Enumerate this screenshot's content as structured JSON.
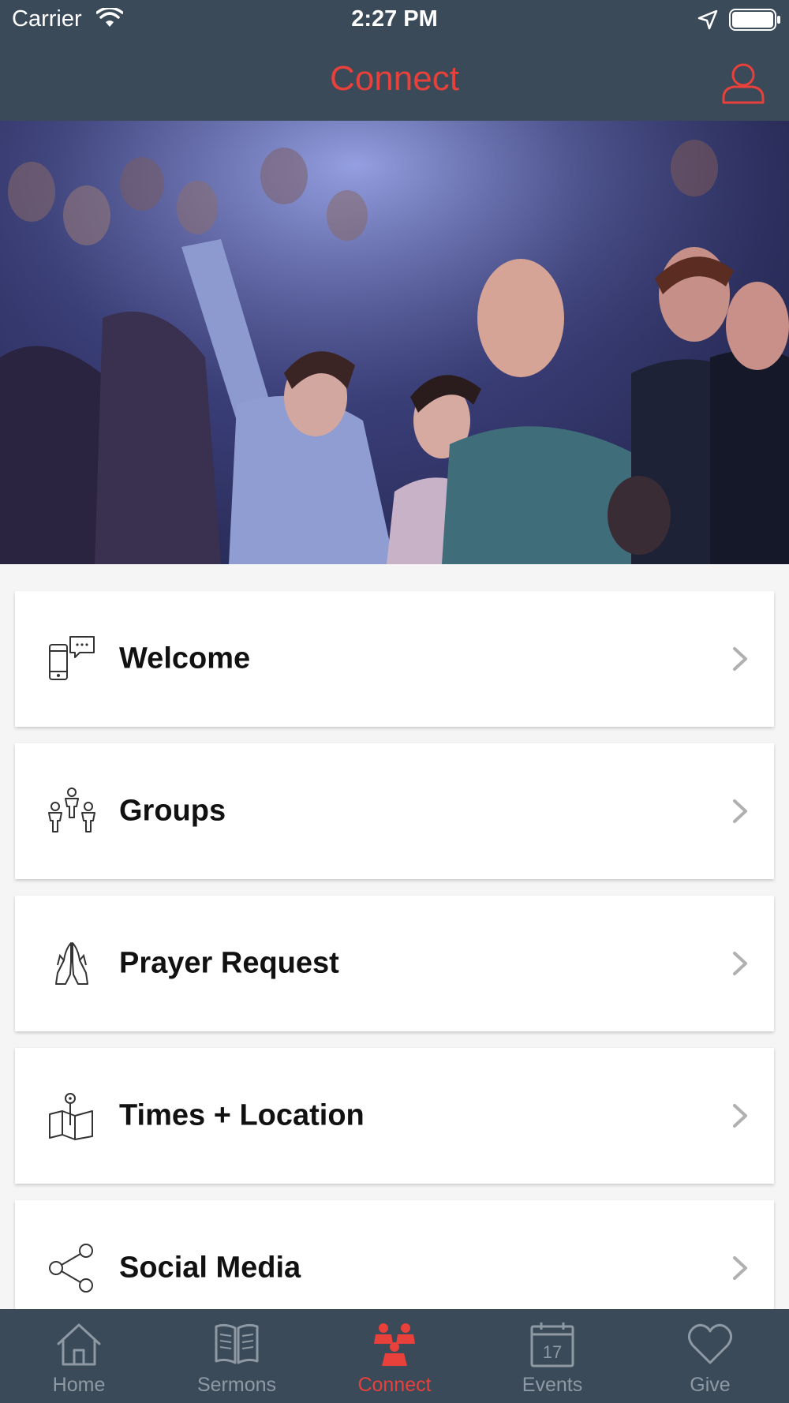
{
  "status_bar": {
    "carrier": "Carrier",
    "time": "2:27 PM"
  },
  "nav": {
    "title": "Connect"
  },
  "menu": [
    {
      "label": "Welcome",
      "icon": "phone-chat-icon"
    },
    {
      "label": "Groups",
      "icon": "group-people-icon"
    },
    {
      "label": "Prayer Request",
      "icon": "praying-hands-icon"
    },
    {
      "label": "Times + Location",
      "icon": "map-pin-icon"
    },
    {
      "label": "Social Media",
      "icon": "share-icon"
    }
  ],
  "tabs": [
    {
      "label": "Home",
      "icon": "home-icon"
    },
    {
      "label": "Sermons",
      "icon": "book-icon"
    },
    {
      "label": "Connect",
      "icon": "people-icon",
      "active": true
    },
    {
      "label": "Events",
      "icon": "calendar-icon",
      "calendar_day": "17"
    },
    {
      "label": "Give",
      "icon": "heart-icon"
    }
  ],
  "colors": {
    "header_bg": "#3b4a58",
    "accent": "#e8403a",
    "tab_inactive": "#8e99a4",
    "page_bg": "#f5f5f5"
  }
}
